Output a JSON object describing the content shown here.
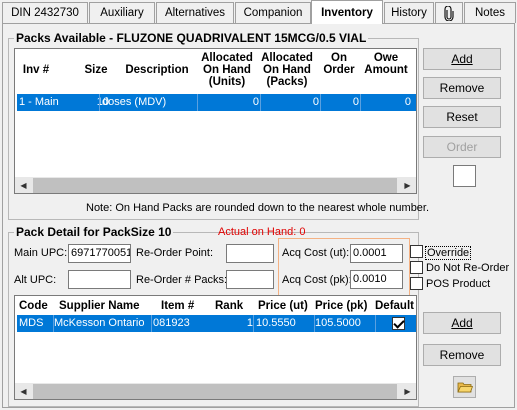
{
  "tabs": [
    {
      "label": "DIN 2432730",
      "active": false
    },
    {
      "label": "Auxiliary",
      "active": false
    },
    {
      "label": "Alternatives",
      "active": false
    },
    {
      "label": "Companion",
      "active": false
    },
    {
      "label": "Inventory",
      "active": true
    },
    {
      "label": "History",
      "active": false
    },
    {
      "label": "",
      "icon": "paperclip-icon",
      "active": false
    },
    {
      "label": "Notes",
      "active": false
    }
  ],
  "packs": {
    "title": "Packs Available - FLUZONE QUADRIVALENT 15MCG/0.5 VIAL",
    "columns": [
      "Inv #",
      "Size",
      "Description",
      "Allocated\nOn Hand\n(Units)",
      "Allocated\nOn Hand\n(Packs)",
      "On\nOrder",
      "Owe\nAmount"
    ],
    "rows": [
      {
        "inv": "1 - Main",
        "size": "10",
        "description": "doses (MDV)",
        "alloc_units": "0",
        "alloc_packs": "0",
        "on_order": "0",
        "owe": "0"
      }
    ],
    "note": "Note: On Hand Packs are rounded down to the nearest whole number.",
    "buttons": {
      "add": "Add",
      "remove": "Remove",
      "reset": "Reset",
      "order": "Order"
    }
  },
  "detail": {
    "title": "Pack Detail for PackSize 10",
    "actual_on_hand": "Actual on Hand:  0",
    "main_upc_label": "Main UPC:",
    "main_upc_value": "6971770051",
    "alt_upc_label": "Alt UPC:",
    "alt_upc_value": "",
    "reorder_point_label": "Re-Order Point:",
    "reorder_point_value": "",
    "reorder_packs_label": "Re-Order # Packs:",
    "reorder_packs_value": "",
    "acq_cost_ut_label": "Acq Cost (ut):",
    "acq_cost_ut_value": "0.0001",
    "acq_cost_pk_label": "Acq Cost (pk):",
    "acq_cost_pk_value": "0.0010",
    "override_label": "Override",
    "override_checked": false,
    "do_not_reorder_label": "Do Not Re-Order",
    "do_not_reorder_checked": false,
    "pos_product_label": "POS Product",
    "pos_product_checked": false
  },
  "suppliers": {
    "columns": [
      "Code",
      "Supplier Name",
      "Item #",
      "Rank",
      "Price (ut)",
      "Price (pk)",
      "Default"
    ],
    "rows": [
      {
        "code": "MDS",
        "name": "McKesson Ontario",
        "item": "081923",
        "rank": "1",
        "price_ut": "10.5550",
        "price_pk": "105.5000",
        "default": true
      }
    ],
    "buttons": {
      "add": "Add",
      "remove": "Remove"
    }
  },
  "colors": {
    "selection": "#0078d7",
    "actual_on_hand": "#e00000",
    "acq_highlight": "#f4b183"
  }
}
